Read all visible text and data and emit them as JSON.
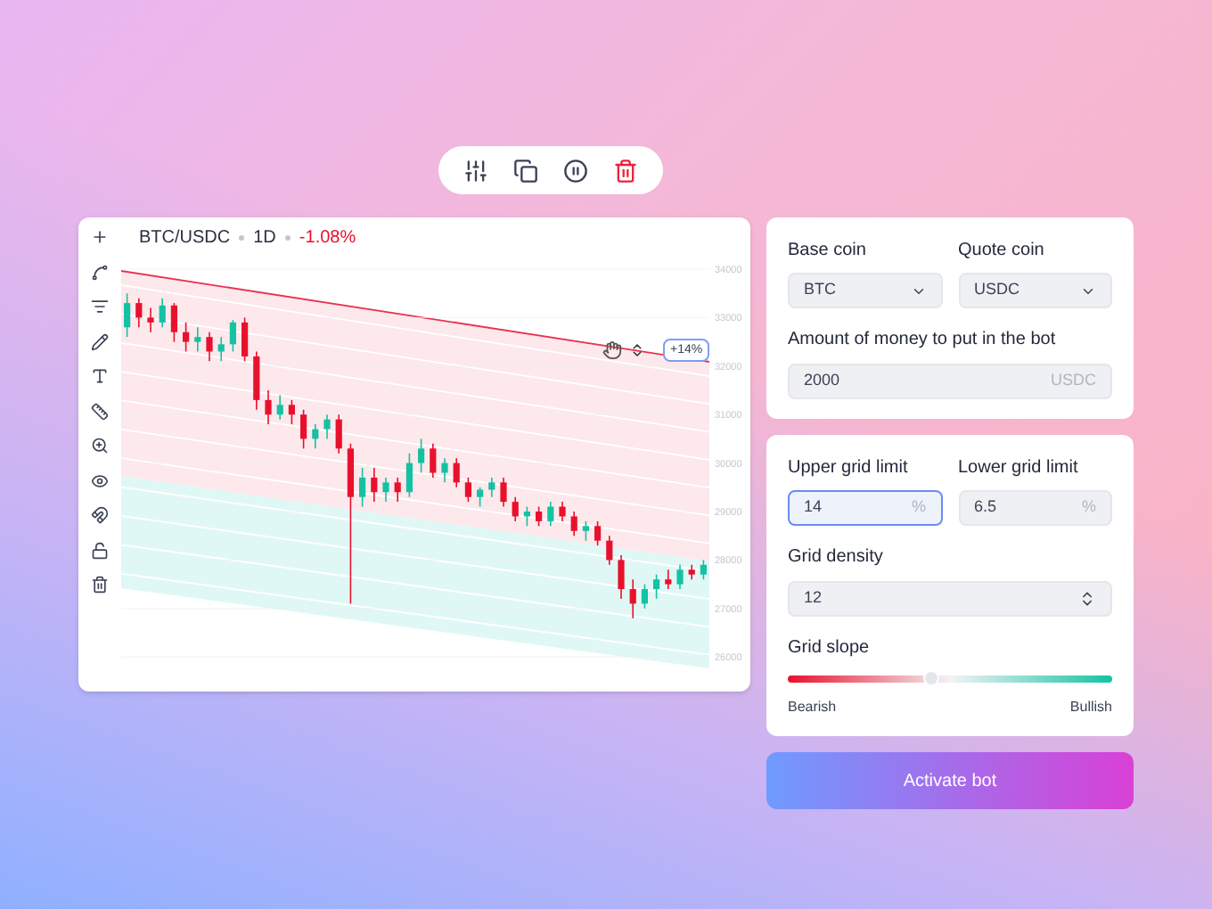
{
  "chart": {
    "pair": "BTC/USDC",
    "interval": "1D",
    "change": "-1.08%",
    "handle_label": "+14%",
    "chart_data": {
      "type": "candlestick",
      "ylim": [
        26000,
        34000
      ],
      "grid": true,
      "yticks": [
        34000,
        33000,
        32000,
        31000,
        30000,
        29000,
        28000,
        27000,
        26000
      ],
      "ohlc": [
        [
          32800,
          33500,
          32600,
          33300
        ],
        [
          33300,
          33400,
          32800,
          33000
        ],
        [
          33000,
          33200,
          32700,
          32900
        ],
        [
          32900,
          33400,
          32800,
          33250
        ],
        [
          33250,
          33300,
          32500,
          32700
        ],
        [
          32700,
          32900,
          32300,
          32500
        ],
        [
          32500,
          32800,
          32300,
          32600
        ],
        [
          32600,
          32700,
          32100,
          32300
        ],
        [
          32300,
          32600,
          32100,
          32450
        ],
        [
          32450,
          32950,
          32300,
          32900
        ],
        [
          32900,
          33000,
          32100,
          32200
        ],
        [
          32200,
          32300,
          31100,
          31300
        ],
        [
          31300,
          31500,
          30800,
          31000
        ],
        [
          31000,
          31400,
          30900,
          31200
        ],
        [
          31200,
          31300,
          30800,
          31000
        ],
        [
          31000,
          31100,
          30300,
          30500
        ],
        [
          30500,
          30800,
          30300,
          30700
        ],
        [
          30700,
          31000,
          30500,
          30900
        ],
        [
          30900,
          31000,
          30200,
          30300
        ],
        [
          30300,
          30400,
          27100,
          29300
        ],
        [
          29300,
          29900,
          29100,
          29700
        ],
        [
          29700,
          29900,
          29200,
          29400
        ],
        [
          29400,
          29700,
          29200,
          29600
        ],
        [
          29600,
          29700,
          29200,
          29400
        ],
        [
          29400,
          30200,
          29300,
          30000
        ],
        [
          30000,
          30500,
          29800,
          30300
        ],
        [
          30300,
          30400,
          29700,
          29800
        ],
        [
          29800,
          30100,
          29600,
          30000
        ],
        [
          30000,
          30100,
          29500,
          29600
        ],
        [
          29600,
          29700,
          29200,
          29300
        ],
        [
          29300,
          29500,
          29100,
          29450
        ],
        [
          29450,
          29700,
          29300,
          29600
        ],
        [
          29600,
          29700,
          29100,
          29200
        ],
        [
          29200,
          29300,
          28800,
          28900
        ],
        [
          28900,
          29100,
          28700,
          29000
        ],
        [
          29000,
          29100,
          28700,
          28800
        ],
        [
          28800,
          29200,
          28700,
          29100
        ],
        [
          29100,
          29200,
          28800,
          28900
        ],
        [
          28900,
          29000,
          28500,
          28600
        ],
        [
          28600,
          28800,
          28400,
          28700
        ],
        [
          28700,
          28800,
          28300,
          28400
        ],
        [
          28400,
          28500,
          27900,
          28000
        ],
        [
          28000,
          28100,
          27200,
          27400
        ],
        [
          27400,
          27600,
          26800,
          27100
        ],
        [
          27100,
          27500,
          27000,
          27400
        ],
        [
          27400,
          27700,
          27200,
          27600
        ],
        [
          27600,
          27800,
          27400,
          27500
        ],
        [
          27500,
          27900,
          27400,
          27800
        ],
        [
          27800,
          27900,
          27600,
          27700
        ],
        [
          27700,
          28000,
          27600,
          27900
        ]
      ]
    }
  },
  "coin_card": {
    "base_label": "Base coin",
    "base_value": "BTC",
    "quote_label": "Quote coin",
    "quote_value": "USDC",
    "amount_label": "Amount of money to put in the bot",
    "amount_value": "2000",
    "amount_unit": "USDC"
  },
  "grid_card": {
    "upper_label": "Upper grid limit",
    "upper_value": "14",
    "upper_unit": "%",
    "upper_focused": true,
    "lower_label": "Lower grid limit",
    "lower_value": "6.5",
    "lower_unit": "%",
    "lower_focused": false,
    "density_label": "Grid density",
    "density_value": "12",
    "slope_label": "Grid slope",
    "level": 0.44,
    "slope_min": "Bearish",
    "slope_max": "Bullish"
  },
  "activate_button": "Activate bot"
}
